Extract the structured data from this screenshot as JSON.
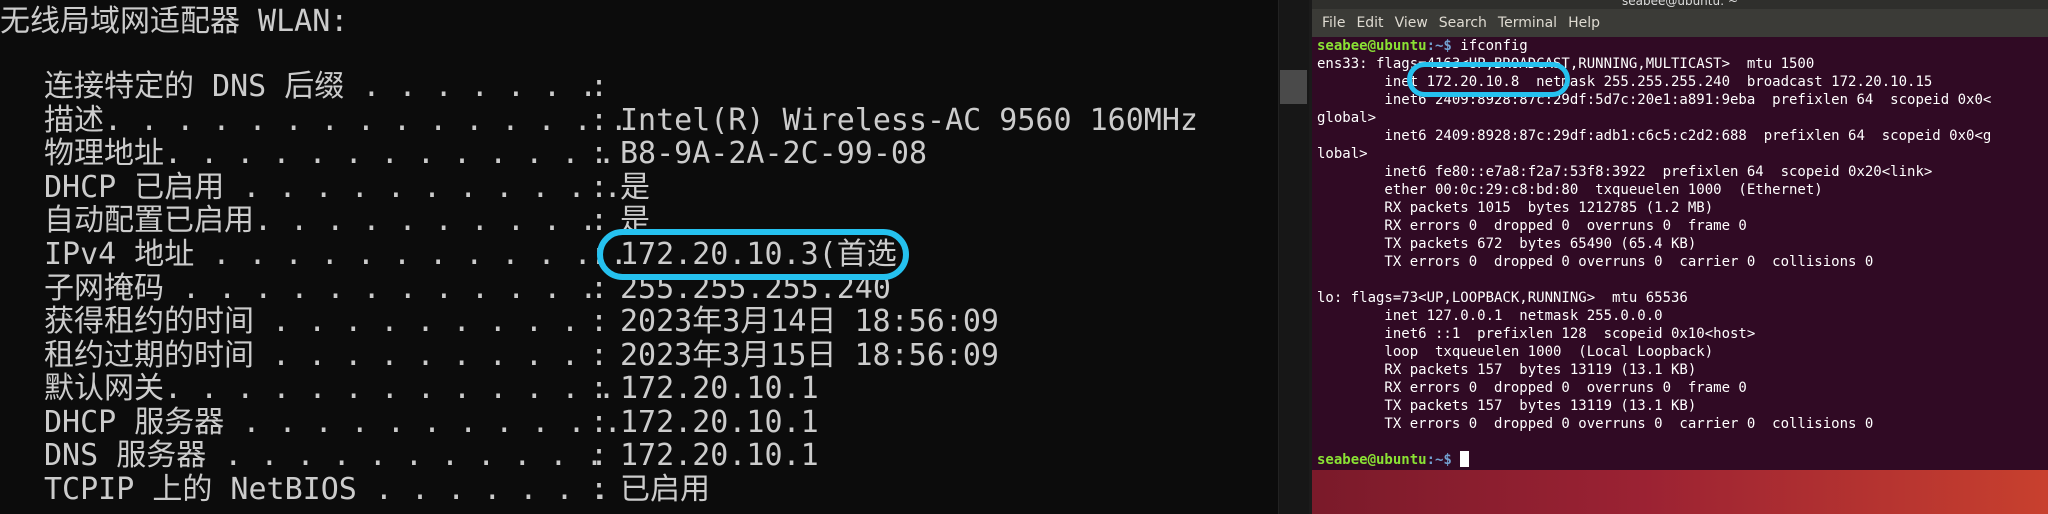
{
  "cmd": {
    "header": "无线局域网适配器 WLAN:",
    "rows": [
      {
        "label": "连接特定的 DNS 后缀 . . . . . . .",
        "value": ""
      },
      {
        "label": "描述. . . . . . . . . . . . . . .",
        "value": "Intel(R) Wireless-AC 9560 160MHz"
      },
      {
        "label": "物理地址. . . . . . . . . . . . .",
        "value": "B8-9A-2A-2C-99-08"
      },
      {
        "label": "DHCP 已启用 . . . . . . . . . . .",
        "value": "是"
      },
      {
        "label": "自动配置已启用. . . . . . . . . .",
        "value": "是"
      },
      {
        "label": "IPv4 地址 . . . . . . . . . . . .",
        "value": "172.20.10.3(首选)"
      },
      {
        "label": "子网掩码 . . . . . . . . . . . .",
        "value": "255.255.255.240"
      },
      {
        "label": "获得租约的时间 . . . . . . . . .",
        "value": "2023年3月14日 18:56:09"
      },
      {
        "label": "租约过期的时间 . . . . . . . . .",
        "value": "2023年3月15日 18:56:09"
      },
      {
        "label": "默认网关. . . . . . . . . . . . .",
        "value": "172.20.10.1"
      },
      {
        "label": "DHCP 服务器 . . . . . . . . . . .",
        "value": "172.20.10.1"
      },
      {
        "label": "DNS 服务器 . . . . . . . . . . .",
        "value": "172.20.10.1"
      },
      {
        "label": "TCPIP 上的 NetBIOS . . . . . . .",
        "value": "已启用"
      }
    ]
  },
  "terminal": {
    "title": "seabee@ubuntu: ~",
    "menu": [
      "File",
      "Edit",
      "View",
      "Search",
      "Terminal",
      "Help"
    ],
    "prompt_user": "seabee@ubuntu",
    "prompt_path": ":~$",
    "command": " ifconfig",
    "output": [
      "ens33: flags=4163<UP,BROADCAST,RUNNING,MULTICAST>  mtu 1500",
      "        inet 172.20.10.8  netmask 255.255.255.240  broadcast 172.20.10.15",
      "        inet6 2409:8928:87c:29df:5d7c:20e1:a891:9eba  prefixlen 64  scopeid 0x0<",
      "global>",
      "        inet6 2409:8928:87c:29df:adb1:c6c5:c2d2:688  prefixlen 64  scopeid 0x0<g",
      "lobal>",
      "        inet6 fe80::e7a8:f2a7:53f8:3922  prefixlen 64  scopeid 0x20<link>",
      "        ether 00:0c:29:c8:bd:80  txqueuelen 1000  (Ethernet)",
      "        RX packets 1015  bytes 1212785 (1.2 MB)",
      "        RX errors 0  dropped 0  overruns 0  frame 0",
      "        TX packets 672  bytes 65490 (65.4 KB)",
      "        TX errors 0  dropped 0 overruns 0  carrier 0  collisions 0",
      "",
      "lo: flags=73<UP,LOOPBACK,RUNNING>  mtu 65536",
      "        inet 127.0.0.1  netmask 255.0.0.0",
      "        inet6 ::1  prefixlen 128  scopeid 0x10<host>",
      "        loop  txqueuelen 1000  (Local Loopback)",
      "        RX packets 157  bytes 13119 (13.1 KB)",
      "        RX errors 0  dropped 0  overruns 0  frame 0",
      "        TX packets 157  bytes 13119 (13.1 KB)",
      "        TX errors 0  dropped 0 overruns 0  carrier 0  collisions 0",
      ""
    ]
  },
  "colors": {
    "highlight": "#25c1ef",
    "cmd_bg": "#0c0c0c",
    "terminal_bg": "#300a24",
    "prompt_green": "#8ae234",
    "prompt_blue": "#729fcf"
  }
}
